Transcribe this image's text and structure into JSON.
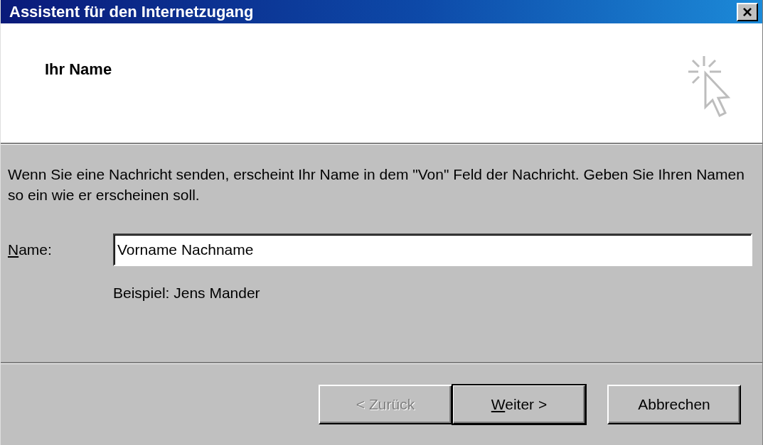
{
  "window": {
    "title": "Assistent für den Internetzugang",
    "close_button": "×"
  },
  "header": {
    "title": "Ihr Name"
  },
  "description": "Wenn Sie eine Nachricht senden, erscheint Ihr Name in dem \"Von\" Feld der Nachricht. Geben Sie Ihren Namen so ein wie er erscheinen soll.",
  "name_field": {
    "label": "Name:",
    "value": "Vorname Nachname",
    "focused": true
  },
  "example": "Beispiel: Jens Mander",
  "buttons": [
    {
      "label": "< Zurück",
      "disabled": true,
      "default": false
    },
    {
      "label": "Weiter >",
      "disabled": false,
      "default": true
    },
    {
      "label": "Abbrechen",
      "disabled": false,
      "default": false
    }
  ]
}
